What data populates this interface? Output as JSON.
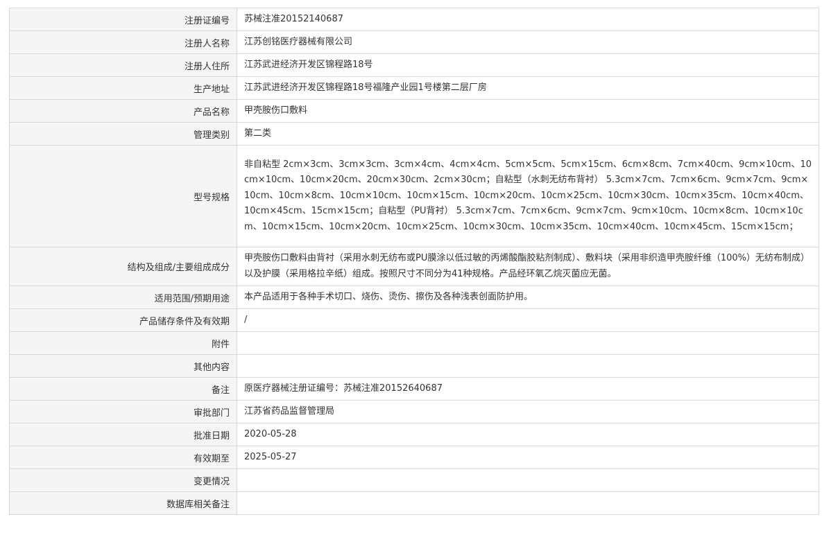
{
  "rows": [
    {
      "label": "注册证编号",
      "value": "苏械注准20152140687"
    },
    {
      "label": "注册人名称",
      "value": "江苏创铭医疗器械有限公司"
    },
    {
      "label": "注册人住所",
      "value": "江苏武进经济开发区锦程路18号"
    },
    {
      "label": "生产地址",
      "value": "江苏武进经济开发区锦程路18号福隆产业园1号楼第二层厂房"
    },
    {
      "label": "产品名称",
      "value": "甲壳胺伤口敷料"
    },
    {
      "label": "管理类别",
      "value": "第二类"
    },
    {
      "label": "型号规格",
      "value": "非自粘型 2cm×3cm、3cm×3cm、3cm×4cm、4cm×4cm、5cm×5cm、5cm×15cm、6cm×8cm、7cm×40cm、9cm×10cm、10cm×10cm、10cm×20cm、20cm×30cm、2cm×30cm；自粘型（水刺无纺布背衬） 5.3cm×7cm、7cm×6cm、9cm×7cm、9cm×10cm、10cm×8cm、10cm×10cm、10cm×15cm、10cm×20cm、10cm×25cm、10cm×30cm、10cm×35cm、10cm×40cm、10cm×45cm、15cm×15cm；自粘型（PU背衬） 5.3cm×7cm、7cm×6cm、9cm×7cm、9cm×10cm、10cm×8cm、10cm×10cm、10cm×15cm、10cm×20cm、10cm×25cm、10cm×30cm、10cm×35cm、10cm×40cm、10cm×45cm、15cm×15cm；"
    },
    {
      "label": "结构及组成/主要组成成分",
      "value": "甲壳胺伤口敷料由背衬（采用水刺无纺布或PU膜涂以低过敏的丙烯酸酯胶粘剂制成）、敷料块（采用非织造甲壳胺纤维（100%）无纺布制成）以及护膜（采用格拉辛纸）组成。按照尺寸不同分为41种规格。产品经环氧乙烷灭菌应无菌。"
    },
    {
      "label": "适用范围/预期用途",
      "value": "本产品适用于各种手术切口、烧伤、烫伤、擦伤及各种浅表创面防护用。"
    },
    {
      "label": "产品储存条件及有效期",
      "value": "/"
    },
    {
      "label": "附件",
      "value": ""
    },
    {
      "label": "其他内容",
      "value": ""
    },
    {
      "label": "备注",
      "value": "原医疗器械注册证编号：苏械注准20152640687"
    },
    {
      "label": "审批部门",
      "value": "江苏省药品监督管理局"
    },
    {
      "label": "批准日期",
      "value": "2020-05-28"
    },
    {
      "label": "有效期至",
      "value": "2025-05-27"
    },
    {
      "label": "变更情况",
      "value": ""
    },
    {
      "label": "数据库相关备注",
      "value": ""
    }
  ]
}
